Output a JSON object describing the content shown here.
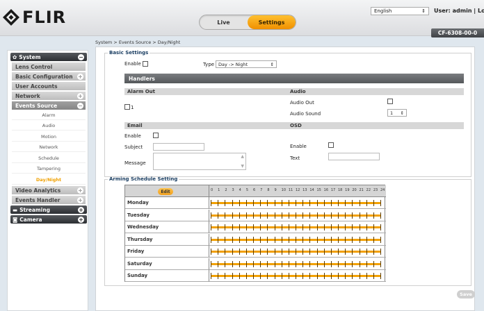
{
  "header": {
    "logo_text": "FLIR",
    "modes": [
      {
        "label": "Live",
        "active": false
      },
      {
        "label": "Settings",
        "active": true
      }
    ],
    "language": "English",
    "user_line": "User: admin | Logou",
    "model": "CF-6308-00-0"
  },
  "breadcrumb": "System > Events Source > Day/Night",
  "sidebar": {
    "sections": [
      {
        "label": "System",
        "icon": "gear-icon",
        "toggle": "−"
      },
      {
        "label": "Streaming",
        "icon": "monitor-icon",
        "toggle": "+"
      },
      {
        "label": "Camera",
        "icon": "camera-icon",
        "toggle": "+"
      }
    ],
    "items": [
      {
        "label": "Lens Control",
        "toggle": ""
      },
      {
        "label": "Basic Configuration",
        "toggle": "+"
      },
      {
        "label": "User Accounts",
        "toggle": ""
      },
      {
        "label": "Network",
        "toggle": "+"
      },
      {
        "label": "Events Source",
        "toggle": "−"
      },
      {
        "label": "Video Analytics",
        "toggle": "+"
      },
      {
        "label": "Events Handler",
        "toggle": "+"
      }
    ],
    "sub_items": [
      "Alarm",
      "Audio",
      "Motion",
      "Network",
      "Schedule",
      "Tampering",
      "Day/Night"
    ],
    "active_sub": "Day/Night"
  },
  "basic": {
    "legend": "Basic Settings",
    "enable_label": "Enable",
    "type_label": "Type",
    "type_value": "Day -> Night",
    "handlers_title": "Handlers",
    "alarm_out_title": "Alarm Out",
    "alarm_out_item": "1",
    "audio_title": "Audio",
    "audio_out_label": "Audio Out",
    "audio_sound_label": "Audio Sound",
    "audio_sound_value": "1",
    "email_title": "Email",
    "email_enable_label": "Enable",
    "subject_label": "Subject",
    "message_label": "Message",
    "osd_title": "OSD",
    "osd_enable_label": "Enable",
    "osd_text_label": "Text"
  },
  "arming": {
    "legend": "Arming Schedule Setting",
    "edit_label": "Edit",
    "hours": [
      "0",
      "1",
      "2",
      "3",
      "4",
      "5",
      "6",
      "7",
      "8",
      "9",
      "10",
      "11",
      "12",
      "13",
      "14",
      "15",
      "16",
      "17",
      "18",
      "19",
      "20",
      "21",
      "22",
      "23",
      "24"
    ],
    "days": [
      "Monday",
      "Tuesday",
      "Wednesday",
      "Thursday",
      "Friday",
      "Saturday",
      "Sunday"
    ],
    "schedule_fill_color": "#f2a000"
  },
  "save_label": "Save"
}
